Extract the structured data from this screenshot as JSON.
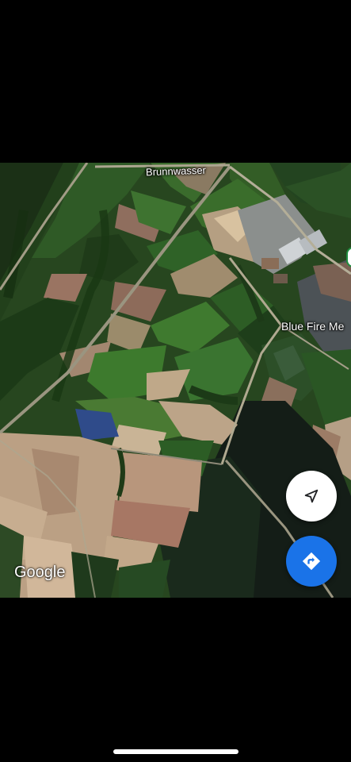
{
  "map": {
    "view": "satellite",
    "labels": {
      "street": "Brunnwasser",
      "poi": "Blue Fire Me"
    },
    "attribution": "Google"
  },
  "controls": {
    "location_icon": "navigation-arrow-icon",
    "directions_icon": "directions-turn-right-icon",
    "directions_color": "#1a73e8",
    "location_color": "#ffffff"
  },
  "system": {
    "home_indicator": true
  }
}
